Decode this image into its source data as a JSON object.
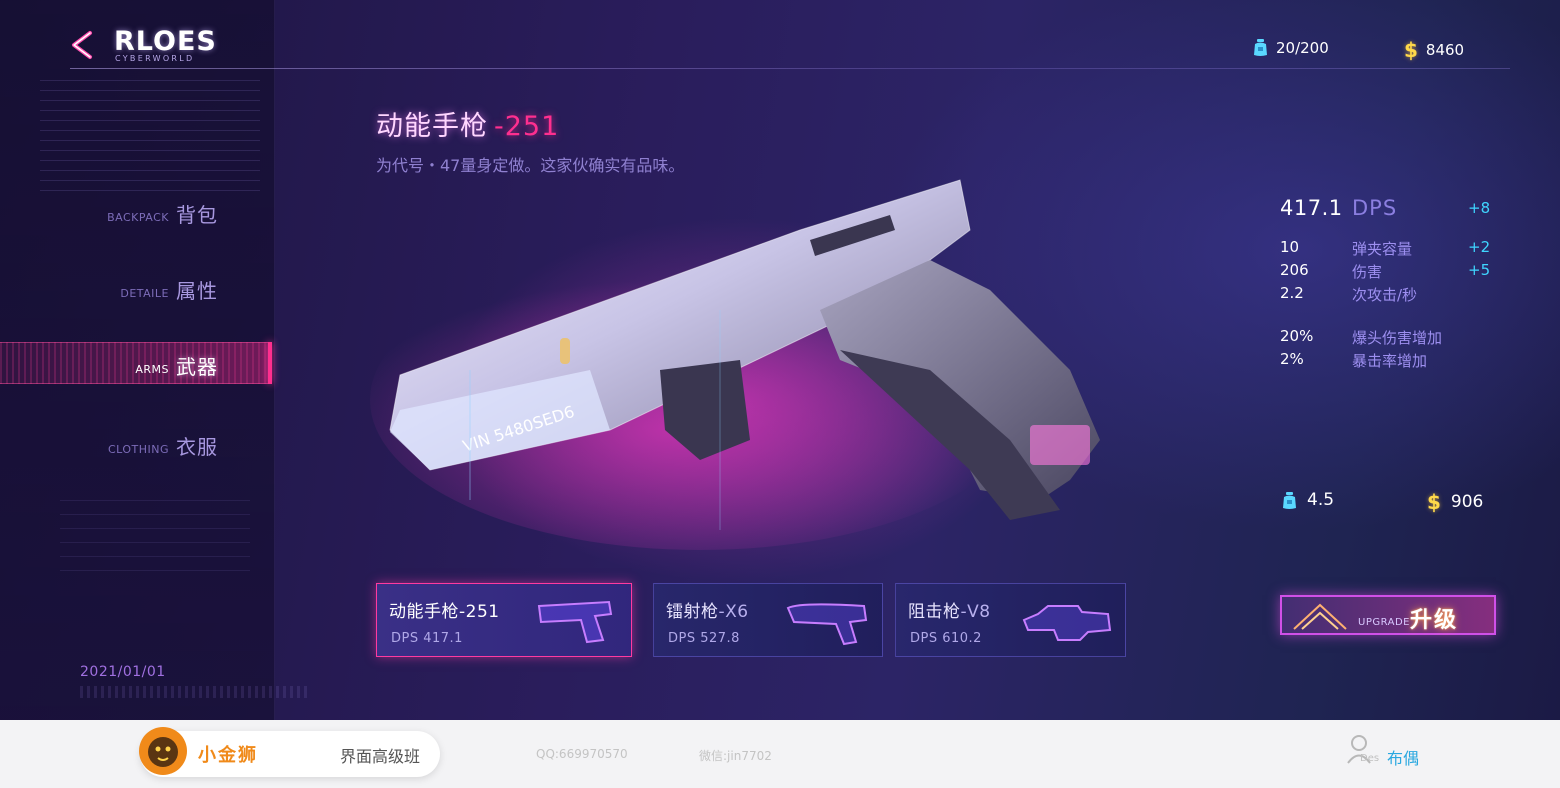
{
  "header": {
    "logo_title": "RLOES",
    "logo_subtitle": "CYBERWORLD",
    "energy": "20/200",
    "money_symbol": "$",
    "money": "8460"
  },
  "nav": {
    "items": [
      {
        "en": "BACKPACK",
        "cn": "背包",
        "active": false
      },
      {
        "en": "DETAILE",
        "cn": "属性",
        "active": false
      },
      {
        "en": "ARMS",
        "cn": "武器",
        "active": true
      },
      {
        "en": "CLOTHING",
        "cn": "衣服",
        "active": false
      }
    ]
  },
  "date": "2021/01/01",
  "weapon": {
    "name": "动能手枪",
    "code": "-251",
    "description": "为代号・47量身定做。这家伙确实有品味。",
    "serial": "VIN 5480SED6"
  },
  "stats": {
    "dps_value": "417.1",
    "dps_label": "DPS",
    "dps_bonus": "+8",
    "rows": [
      {
        "value": "10",
        "label": "弹夹容量",
        "bonus": "+2"
      },
      {
        "value": "206",
        "label": "伤害",
        "bonus": "+5"
      },
      {
        "value": "2.2",
        "label": "次攻击/秒",
        "bonus": ""
      }
    ],
    "extra_rows": [
      {
        "value": "20%",
        "label": "爆头伤害增加"
      },
      {
        "value": "2%",
        "label": "暴击率增加"
      }
    ]
  },
  "cost": {
    "energy": "4.5",
    "money_symbol": "$",
    "money": "906"
  },
  "weapon_cards": [
    {
      "name": "动能手枪",
      "code": "-251",
      "dps": "DPS 417.1",
      "active": true
    },
    {
      "name": "镭射枪",
      "code": "-X6",
      "dps": "DPS 527.8",
      "active": false
    },
    {
      "name": "阻击枪",
      "code": "-V8",
      "dps": "DPS 610.2",
      "active": false
    }
  ],
  "upgrade": {
    "en": "UPGRADE",
    "cn": "升级"
  },
  "footer": {
    "brand": "小金狮",
    "course": "界面高级班",
    "qq": "QQ:669970570",
    "wechat": "微信:jin7702",
    "des": "Des",
    "author": "布偶"
  },
  "colors": {
    "accent_pink": "#ff2f8f",
    "bonus_cyan": "#3fd6ff",
    "stat_label": "#9d8ff0",
    "money_gold": "#ffd84a",
    "footer_brand": "#f08a1a",
    "footer_author": "#2aa8e0"
  },
  "icons": [
    "back-chevron-icon",
    "energy-bag-icon",
    "dollar-icon",
    "upgrade-chevron-icon",
    "lion-logo-icon",
    "user-icon"
  ]
}
